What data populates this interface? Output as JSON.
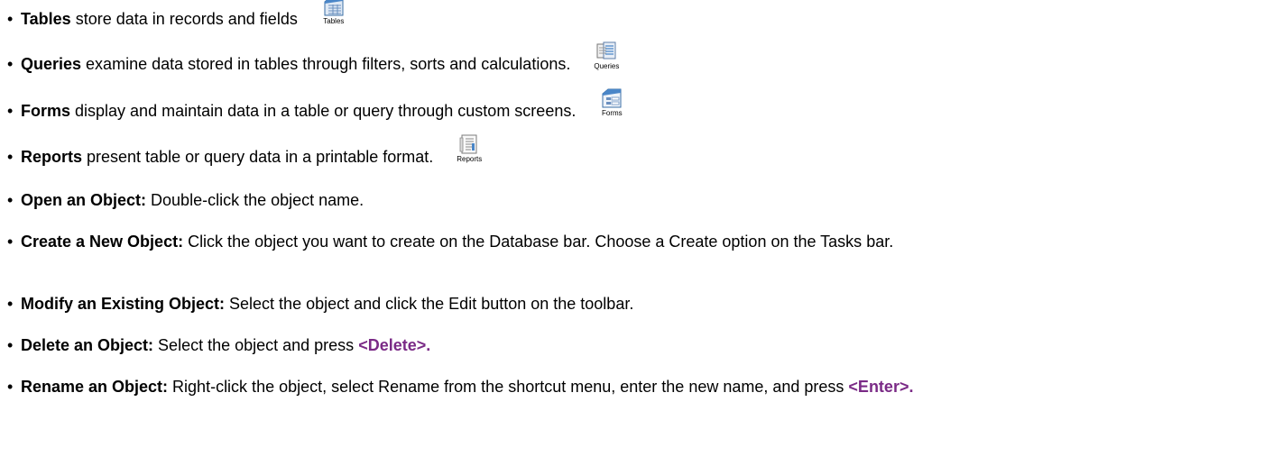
{
  "items": [
    {
      "bold": "Tables",
      "text": " store data in records and fields",
      "icon": "table-icon",
      "icon_label": "Tables"
    },
    {
      "bold": "Queries",
      "text": " examine data stored in tables through filters, sorts and calculations.",
      "icon": "query-icon",
      "icon_label": "Queries"
    },
    {
      "bold": "Forms",
      "text": " display and maintain data in a table or query through custom screens.",
      "icon": "form-icon",
      "icon_label": "Forms"
    },
    {
      "bold": "Reports",
      "text": " present table or query data in a printable format.",
      "icon": "report-icon",
      "icon_label": "Reports"
    },
    {
      "bold": "Open an Object:",
      "text": " Double-click the object name."
    },
    {
      "bold": "Create a New Object:",
      "text": "  Click the object you want to create on the Database bar. Choose a Create option on the Tasks bar."
    },
    {
      "bold": "Modify an Existing Object:",
      "text": " Select the object and click the Edit button on the toolbar."
    },
    {
      "bold": "Delete an Object:",
      "text": " Select the object and press ",
      "key": "<Delete>."
    },
    {
      "bold": "Rename an Object:",
      "text": " Right-click the object, select Rename from the shortcut menu, enter the new name, and press ",
      "key": "<Enter>."
    }
  ],
  "colors": {
    "key": "#7a2a86",
    "icon_blue": "#4a86c8"
  }
}
